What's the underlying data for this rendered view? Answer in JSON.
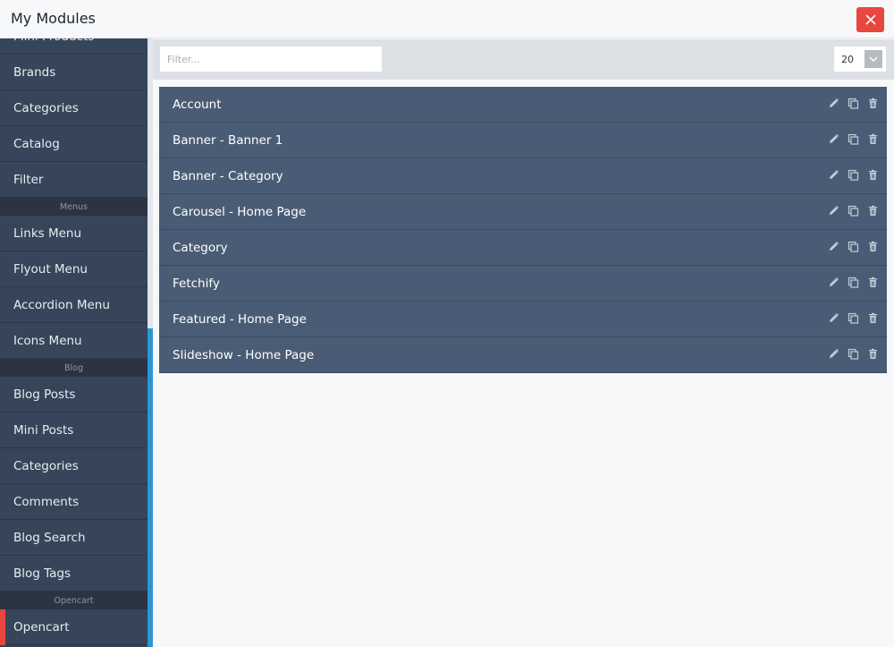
{
  "header": {
    "title": "My Modules"
  },
  "sidebar": {
    "entries": [
      {
        "kind": "item",
        "label": "Mini Products",
        "active": false
      },
      {
        "kind": "item",
        "label": "Brands",
        "active": false
      },
      {
        "kind": "item",
        "label": "Categories",
        "active": false
      },
      {
        "kind": "item",
        "label": "Catalog",
        "active": false
      },
      {
        "kind": "item",
        "label": "Filter",
        "active": false
      },
      {
        "kind": "heading",
        "label": "Menus"
      },
      {
        "kind": "item",
        "label": "Links Menu",
        "active": false
      },
      {
        "kind": "item",
        "label": "Flyout Menu",
        "active": false
      },
      {
        "kind": "item",
        "label": "Accordion Menu",
        "active": false
      },
      {
        "kind": "item",
        "label": "Icons Menu",
        "active": false
      },
      {
        "kind": "heading",
        "label": "Blog"
      },
      {
        "kind": "item",
        "label": "Blog Posts",
        "active": false
      },
      {
        "kind": "item",
        "label": "Mini Posts",
        "active": false
      },
      {
        "kind": "item",
        "label": "Categories",
        "active": false
      },
      {
        "kind": "item",
        "label": "Comments",
        "active": false
      },
      {
        "kind": "item",
        "label": "Blog Search",
        "active": false
      },
      {
        "kind": "item",
        "label": "Blog Tags",
        "active": false
      },
      {
        "kind": "heading",
        "label": "Opencart"
      },
      {
        "kind": "item",
        "label": "Opencart",
        "active": true
      }
    ]
  },
  "toolbar": {
    "filter_placeholder": "Filter...",
    "filter_value": "",
    "per_page": "20"
  },
  "modules": [
    {
      "name": "Account"
    },
    {
      "name": "Banner - Banner 1"
    },
    {
      "name": "Banner - Category"
    },
    {
      "name": "Carousel - Home Page"
    },
    {
      "name": "Category"
    },
    {
      "name": "Fetchify"
    },
    {
      "name": "Featured - Home Page"
    },
    {
      "name": "Slideshow - Home Page"
    }
  ],
  "icons": {
    "close": "close-icon",
    "dropdown": "chevron-down-icon",
    "edit": "pencil-icon",
    "copy": "copy-icon",
    "delete": "trash-icon"
  },
  "colors": {
    "sidebar_bg": "#364559",
    "row_bg": "#4a5c75",
    "accent_active": "#e8463f",
    "scroll_accent": "#2e94d6",
    "close_button": "#e8463f"
  }
}
